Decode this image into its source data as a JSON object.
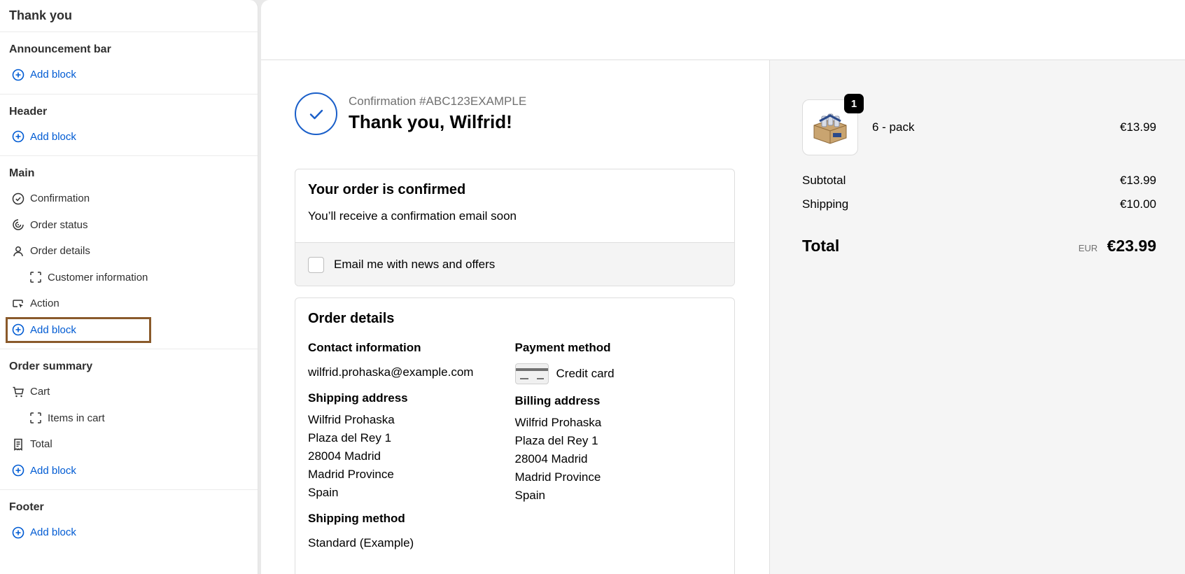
{
  "sidebar": {
    "title": "Thank you",
    "sections": {
      "announcement": {
        "heading": "Announcement bar",
        "add_label": "Add block"
      },
      "header": {
        "heading": "Header",
        "add_label": "Add block"
      },
      "main": {
        "heading": "Main",
        "items": [
          "Confirmation",
          "Order status",
          "Order details",
          "Customer information",
          "Action"
        ],
        "add_label": "Add block"
      },
      "order_summary": {
        "heading": "Order summary",
        "items": [
          "Cart",
          "Items in cart",
          "Total"
        ],
        "add_label": "Add block"
      },
      "footer": {
        "heading": "Footer",
        "add_label": "Add block"
      }
    }
  },
  "confirmation": {
    "number": "Confirmation #ABC123EXAMPLE",
    "thanks": "Thank you, Wilfrid!"
  },
  "order_confirmed": {
    "title": "Your order is confirmed",
    "text": "You’ll receive a confirmation email soon",
    "email_opt_in": "Email me with news and offers"
  },
  "order_details": {
    "title": "Order details",
    "contact_label": "Contact information",
    "contact_email": "wilfrid.prohaska@example.com",
    "shipping_address_label": "Shipping address",
    "shipping_address": [
      "Wilfrid Prohaska",
      "Plaza del Rey 1",
      "28004 Madrid",
      "Madrid Province",
      "Spain"
    ],
    "shipping_method_label": "Shipping method",
    "shipping_method": "Standard (Example)",
    "payment_label": "Payment method",
    "payment_value": "Credit card",
    "billing_label": "Billing address",
    "billing_address": [
      "Wilfrid Prohaska",
      "Plaza del Rey 1",
      "28004 Madrid",
      "Madrid Province",
      "Spain"
    ]
  },
  "summary": {
    "item": {
      "name": "6 - pack",
      "price": "€13.99",
      "qty": "1"
    },
    "subtotal_label": "Subtotal",
    "subtotal": "€13.99",
    "shipping_label": "Shipping",
    "shipping": "€10.00",
    "total_label": "Total",
    "currency": "EUR",
    "total": "€23.99"
  },
  "colors": {
    "accent": "#005bd3",
    "selection": "#8a5a2b"
  }
}
